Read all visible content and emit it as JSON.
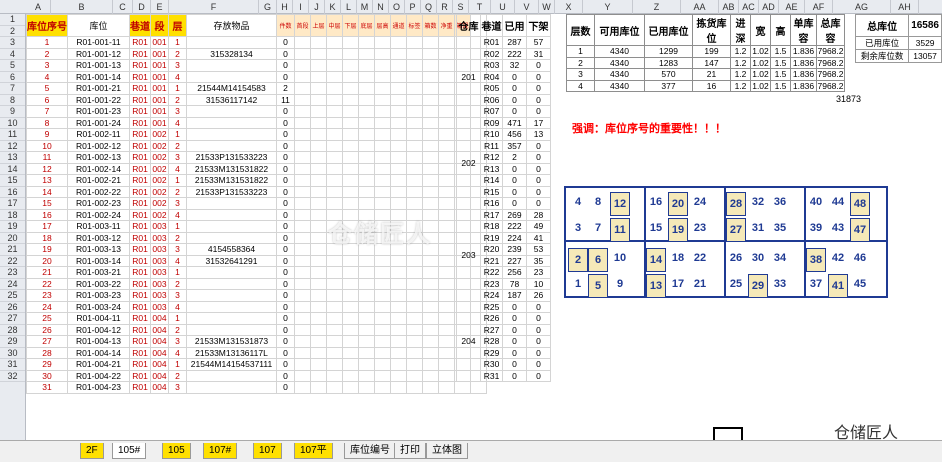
{
  "columns": [
    "A",
    "B",
    "C",
    "D",
    "E",
    "F",
    "G",
    "H",
    "I",
    "J",
    "K",
    "L",
    "M",
    "N",
    "O",
    "P",
    "Q",
    "R",
    "S",
    "T",
    "U",
    "V",
    "W",
    "X",
    "Y",
    "Z",
    "AA",
    "AB",
    "AC",
    "AD",
    "AE",
    "AF",
    "AG",
    "AH"
  ],
  "rows": [
    "1",
    "2",
    "3",
    "4",
    "5",
    "6",
    "7",
    "8",
    "9",
    "10",
    "11",
    "12",
    "13",
    "14",
    "15",
    "16",
    "17",
    "18",
    "19",
    "20",
    "21",
    "22",
    "23",
    "24",
    "25",
    "26",
    "27",
    "28",
    "29",
    "30",
    "31",
    "32"
  ],
  "left_headers": [
    "库位序号",
    "库位",
    "巷道",
    "段",
    "层",
    "存放物品",
    "件数",
    "首段",
    "上层",
    "中层",
    "下层",
    "底层",
    "层高",
    "通道",
    "标签",
    "箱数",
    "净重",
    "箱规"
  ],
  "slots": [
    {
      "seq": "1",
      "loc": "R01-001-11",
      "lane": "R01",
      "sec": "001",
      "lvl": "1",
      "item": "",
      "q": "0"
    },
    {
      "seq": "2",
      "loc": "R01-001-12",
      "lane": "R01",
      "sec": "001",
      "lvl": "2",
      "item": "315328134",
      "q": "0"
    },
    {
      "seq": "3",
      "loc": "R01-001-13",
      "lane": "R01",
      "sec": "001",
      "lvl": "3",
      "item": "",
      "q": "0"
    },
    {
      "seq": "4",
      "loc": "R01-001-14",
      "lane": "R01",
      "sec": "001",
      "lvl": "4",
      "item": "",
      "q": "0"
    },
    {
      "seq": "5",
      "loc": "R01-001-21",
      "lane": "R01",
      "sec": "001",
      "lvl": "1",
      "item": "21544M14154583",
      "q": "2"
    },
    {
      "seq": "6",
      "loc": "R01-001-22",
      "lane": "R01",
      "sec": "001",
      "lvl": "2",
      "item": "31536117142",
      "q": "11"
    },
    {
      "seq": "7",
      "loc": "R01-001-23",
      "lane": "R01",
      "sec": "001",
      "lvl": "3",
      "item": "",
      "q": "0"
    },
    {
      "seq": "8",
      "loc": "R01-001-24",
      "lane": "R01",
      "sec": "001",
      "lvl": "4",
      "item": "",
      "q": "0"
    },
    {
      "seq": "9",
      "loc": "R01-002-11",
      "lane": "R01",
      "sec": "002",
      "lvl": "1",
      "item": "",
      "q": "0"
    },
    {
      "seq": "10",
      "loc": "R01-002-12",
      "lane": "R01",
      "sec": "002",
      "lvl": "2",
      "item": "",
      "q": "0"
    },
    {
      "seq": "11",
      "loc": "R01-002-13",
      "lane": "R01",
      "sec": "002",
      "lvl": "3",
      "item": "21533P131533223",
      "q": "0"
    },
    {
      "seq": "12",
      "loc": "R01-002-14",
      "lane": "R01",
      "sec": "002",
      "lvl": "4",
      "item": "21533M131531822",
      "q": "0"
    },
    {
      "seq": "13",
      "loc": "R01-002-21",
      "lane": "R01",
      "sec": "002",
      "lvl": "1",
      "item": "21533M131531822",
      "q": "0"
    },
    {
      "seq": "14",
      "loc": "R01-002-22",
      "lane": "R01",
      "sec": "002",
      "lvl": "2",
      "item": "21533P131533223",
      "q": "0"
    },
    {
      "seq": "15",
      "loc": "R01-002-23",
      "lane": "R01",
      "sec": "002",
      "lvl": "3",
      "item": "",
      "q": "0"
    },
    {
      "seq": "16",
      "loc": "R01-002-24",
      "lane": "R01",
      "sec": "002",
      "lvl": "4",
      "item": "",
      "q": "0"
    },
    {
      "seq": "17",
      "loc": "R01-003-11",
      "lane": "R01",
      "sec": "003",
      "lvl": "1",
      "item": "",
      "q": "0"
    },
    {
      "seq": "18",
      "loc": "R01-003-12",
      "lane": "R01",
      "sec": "003",
      "lvl": "2",
      "item": "",
      "q": "0"
    },
    {
      "seq": "19",
      "loc": "R01-003-13",
      "lane": "R01",
      "sec": "003",
      "lvl": "3",
      "item": "4154558364",
      "q": "0"
    },
    {
      "seq": "20",
      "loc": "R01-003-14",
      "lane": "R01",
      "sec": "003",
      "lvl": "4",
      "item": "31532641291",
      "q": "0"
    },
    {
      "seq": "21",
      "loc": "R01-003-21",
      "lane": "R01",
      "sec": "003",
      "lvl": "1",
      "item": "",
      "q": "0"
    },
    {
      "seq": "22",
      "loc": "R01-003-22",
      "lane": "R01",
      "sec": "003",
      "lvl": "2",
      "item": "",
      "q": "0"
    },
    {
      "seq": "23",
      "loc": "R01-003-23",
      "lane": "R01",
      "sec": "003",
      "lvl": "3",
      "item": "",
      "q": "0"
    },
    {
      "seq": "24",
      "loc": "R01-003-24",
      "lane": "R01",
      "sec": "003",
      "lvl": "4",
      "item": "",
      "q": "0"
    },
    {
      "seq": "25",
      "loc": "R01-004-11",
      "lane": "R01",
      "sec": "004",
      "lvl": "1",
      "item": "",
      "q": "0"
    },
    {
      "seq": "26",
      "loc": "R01-004-12",
      "lane": "R01",
      "sec": "004",
      "lvl": "2",
      "item": "",
      "q": "0"
    },
    {
      "seq": "27",
      "loc": "R01-004-13",
      "lane": "R01",
      "sec": "004",
      "lvl": "3",
      "item": "21533M131531873",
      "q": "0"
    },
    {
      "seq": "28",
      "loc": "R01-004-14",
      "lane": "R01",
      "sec": "004",
      "lvl": "4",
      "item": "21533M13136117L",
      "q": "0"
    },
    {
      "seq": "29",
      "loc": "R01-004-21",
      "lane": "R01",
      "sec": "004",
      "lvl": "1",
      "item": "21544M14154537111",
      "q": "0"
    },
    {
      "seq": "30",
      "loc": "R01-004-22",
      "lane": "R01",
      "sec": "004",
      "lvl": "2",
      "item": "",
      "q": "0"
    },
    {
      "seq": "31",
      "loc": "R01-004-23",
      "lane": "R01",
      "sec": "004",
      "lvl": "3",
      "item": "",
      "q": "0"
    }
  ],
  "mid_headers": [
    "仓库",
    "巷道",
    "已用",
    "下架"
  ],
  "warehouses": [
    "201",
    "202",
    "203",
    "204"
  ],
  "lanes": [
    [
      "R01",
      "287",
      "57"
    ],
    [
      "R02",
      "222",
      "31"
    ],
    [
      "R03",
      "32",
      "0"
    ],
    [
      "R04",
      "0",
      "0"
    ],
    [
      "R05",
      "0",
      "0"
    ],
    [
      "R06",
      "0",
      "0"
    ],
    [
      "R07",
      "0",
      "0"
    ],
    [
      "R09",
      "471",
      "17"
    ],
    [
      "R10",
      "456",
      "13"
    ],
    [
      "R11",
      "357",
      "0"
    ],
    [
      "R12",
      "2",
      "0"
    ],
    [
      "R13",
      "0",
      "0"
    ],
    [
      "R14",
      "0",
      "0"
    ],
    [
      "R15",
      "0",
      "0"
    ],
    [
      "R16",
      "0",
      "0"
    ],
    [
      "R17",
      "269",
      "28"
    ],
    [
      "R18",
      "222",
      "49"
    ],
    [
      "R19",
      "224",
      "41"
    ],
    [
      "R20",
      "239",
      "53"
    ],
    [
      "R21",
      "227",
      "35"
    ],
    [
      "R22",
      "256",
      "23"
    ],
    [
      "R23",
      "78",
      "10"
    ],
    [
      "R24",
      "187",
      "26"
    ],
    [
      "R25",
      "0",
      "0"
    ],
    [
      "R26",
      "0",
      "0"
    ],
    [
      "R27",
      "0",
      "0"
    ],
    [
      "R28",
      "0",
      "0"
    ],
    [
      "R29",
      "0",
      "0"
    ],
    [
      "R30",
      "0",
      "0"
    ],
    [
      "R31",
      "0",
      "0"
    ]
  ],
  "summary_headers": [
    "层数",
    "可用库位",
    "已用库位",
    "拣货库位",
    "进深",
    "宽",
    "高",
    "单库容",
    "总库容"
  ],
  "summary": [
    [
      "1",
      "4340",
      "1299",
      "199",
      "1.2",
      "1.02",
      "1.5",
      "1.836",
      "7968.2"
    ],
    [
      "2",
      "4340",
      "1283",
      "147",
      "1.2",
      "1.02",
      "1.5",
      "1.836",
      "7968.2"
    ],
    [
      "3",
      "4340",
      "570",
      "21",
      "1.2",
      "1.02",
      "1.5",
      "1.836",
      "7968.2"
    ],
    [
      "4",
      "4340",
      "377",
      "16",
      "1.2",
      "1.02",
      "1.5",
      "1.836",
      "7968.2"
    ]
  ],
  "summary_total": "31873",
  "right": {
    "h1": "总库位",
    "v1": "16586",
    "h2": "已用库位",
    "v2": "3529",
    "h3": "剩余库位数",
    "v3": "13057"
  },
  "note": "强调：库位序号的重要性！！！",
  "map_numbers": [
    {
      "t": "4"
    },
    {
      "t": "8"
    },
    {
      "t": "12",
      "box": true
    },
    {
      "t": "16"
    },
    {
      "t": "20",
      "box": true
    },
    {
      "t": "24"
    },
    {
      "t": "28",
      "box": true
    },
    {
      "t": "32"
    },
    {
      "t": "36"
    },
    {
      "t": "40"
    },
    {
      "t": "44"
    },
    {
      "t": "48",
      "box": true
    },
    {
      "t": "3"
    },
    {
      "t": "7"
    },
    {
      "t": "11",
      "box": true
    },
    {
      "t": "15"
    },
    {
      "t": "19",
      "box": true
    },
    {
      "t": "23"
    },
    {
      "t": "27",
      "box": true
    },
    {
      "t": "31"
    },
    {
      "t": "35"
    },
    {
      "t": "39"
    },
    {
      "t": "43"
    },
    {
      "t": "47",
      "box": true
    },
    {
      "t": "2",
      "box": true
    },
    {
      "t": "6",
      "box": true
    },
    {
      "t": "10"
    },
    {
      "t": "14",
      "box": true
    },
    {
      "t": "18"
    },
    {
      "t": "22"
    },
    {
      "t": "26"
    },
    {
      "t": "30"
    },
    {
      "t": "34"
    },
    {
      "t": "38",
      "box": true
    },
    {
      "t": "42"
    },
    {
      "t": "46"
    },
    {
      "t": "1"
    },
    {
      "t": "5",
      "box": true
    },
    {
      "t": "9"
    },
    {
      "t": "13",
      "box": true
    },
    {
      "t": "17"
    },
    {
      "t": "21"
    },
    {
      "t": "25"
    },
    {
      "t": "29",
      "box": true
    },
    {
      "t": "33"
    },
    {
      "t": "37"
    },
    {
      "t": "41",
      "box": true
    },
    {
      "t": "45"
    }
  ],
  "tabs": [
    "2F",
    "105#",
    "105",
    "107#",
    "107",
    "107平",
    "库位编号",
    "打印",
    "立体图"
  ],
  "watermark": "仓储匠人",
  "logo": "仓储匠人"
}
